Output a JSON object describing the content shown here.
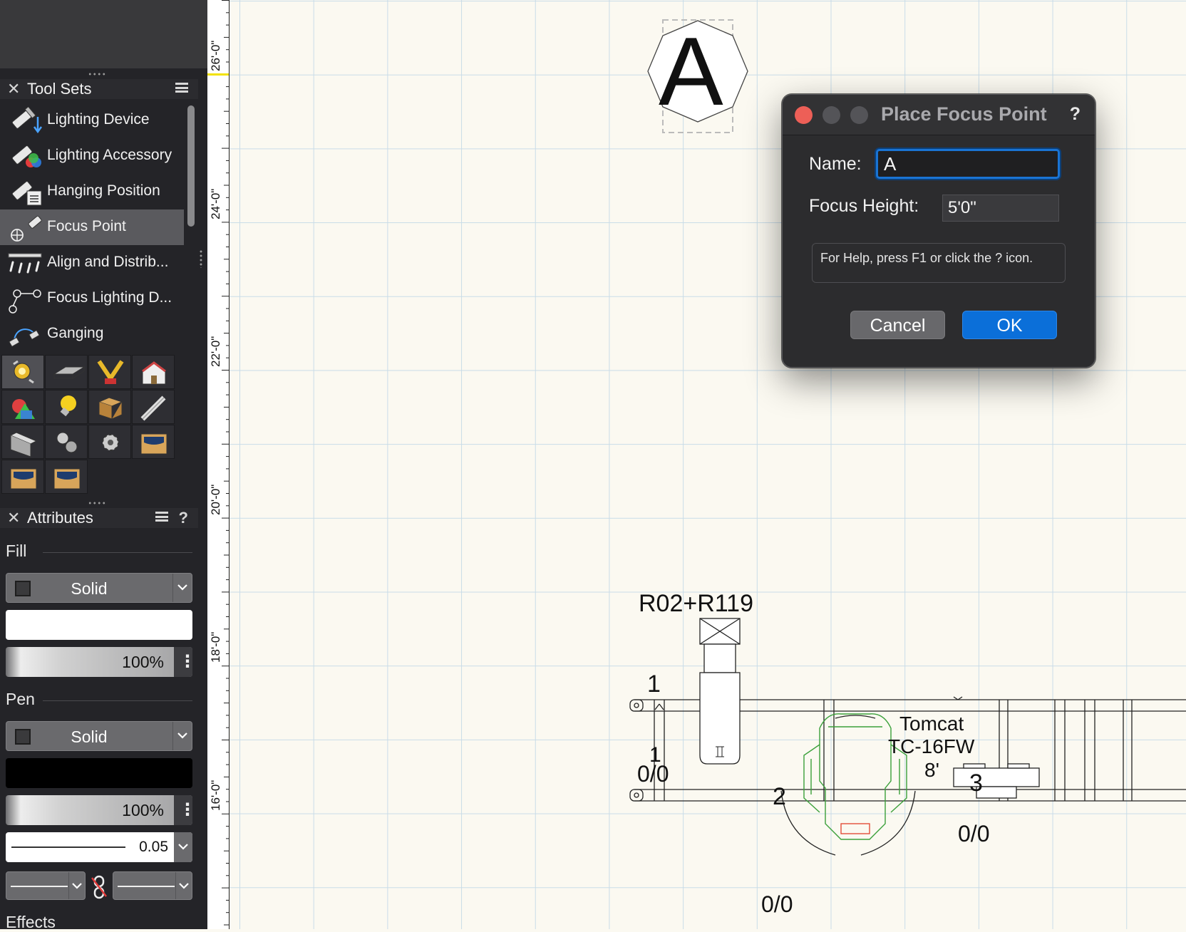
{
  "toolsets_palette": {
    "title": "Tool Sets",
    "items": [
      {
        "label": "Lighting Device",
        "icon": "lighting-device-icon"
      },
      {
        "label": "Lighting Accessory",
        "icon": "lighting-accessory-icon"
      },
      {
        "label": "Hanging Position",
        "icon": "hanging-position-icon"
      },
      {
        "label": "Focus Point",
        "icon": "focus-point-icon",
        "selected": true
      },
      {
        "label": "Align and Distrib...",
        "icon": "align-distribute-icon"
      },
      {
        "label": "Focus Lighting D...",
        "icon": "focus-lighting-device-icon"
      },
      {
        "label": "Ganging",
        "icon": "ganging-icon"
      }
    ],
    "tool_icons": [
      "spotlight-toolset-icon",
      "truss-toolset-icon",
      "lighting-fixture-toolset-icon",
      "building-shell-toolset-icon",
      "visualization-toolset-icon",
      "lightbulb-toolset-icon",
      "furniture-toolset-icon",
      "dims-notes-toolset-icon",
      "steel-beam-toolset-icon",
      "machine-parts-toolset-icon",
      "gear-toolset-icon",
      "custom-toolset-icon",
      "custom-toolset-2-icon",
      "custom-toolset-3-icon"
    ]
  },
  "attributes_palette": {
    "title": "Attributes",
    "fill": {
      "section": "Fill",
      "style": "Solid",
      "color": "#ffffff",
      "opacity": "100%"
    },
    "pen": {
      "section": "Pen",
      "style": "Solid",
      "color": "#000000",
      "opacity": "100%",
      "thickness": "0.05"
    },
    "effects": {
      "section": "Effects"
    }
  },
  "ruler": {
    "labels": [
      "26'-0\"",
      "24'-0\"",
      "22'-0\"",
      "20'-0\"",
      "18'-0\"",
      "16'-0\""
    ]
  },
  "drawing": {
    "focus_point_label": "A",
    "color_label": "R02+R119",
    "fixture1_number": "1",
    "fixture1_sub": "1",
    "fixture1_address": "0/0",
    "fixture2_number": "2",
    "fixture2_address": "0/0",
    "fixture3_label_line1": "Tomcat",
    "fixture3_label_line2": "TC-16FW",
    "fixture3_label_line3": "8'",
    "fixture3_number": "3",
    "fixture3_address": "0/0"
  },
  "dialog": {
    "title": "Place Focus Point",
    "help_label": "?",
    "name_label": "Name:",
    "name_value": "A",
    "focus_height_label": "Focus Height:",
    "focus_height_value": "5'0\"",
    "help_text": "For Help, press F1 or click the ? icon.",
    "cancel_label": "Cancel",
    "ok_label": "OK",
    "colors": {
      "ok": "#0b6fd9",
      "close": "#ed5f57"
    }
  }
}
